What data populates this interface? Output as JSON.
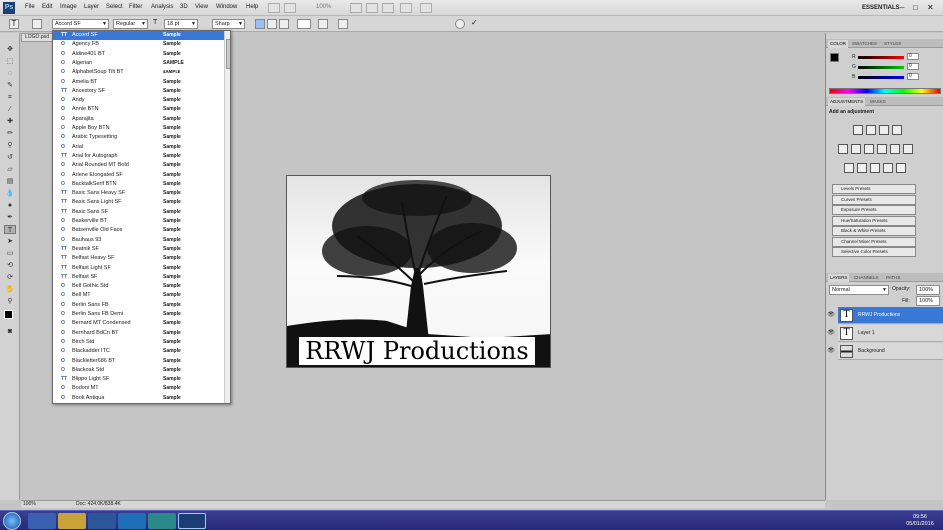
{
  "menubar": {
    "items": [
      "File",
      "Edit",
      "Image",
      "Layer",
      "Select",
      "Filter",
      "Analysis",
      "3D",
      "View",
      "Window",
      "Help"
    ],
    "zoom": "100%",
    "workspace": "ESSENTIALS",
    "window_buttons": [
      "–",
      "□",
      "✕"
    ]
  },
  "options": {
    "tool_icon": "T",
    "font_family": "Accord SF",
    "font_style": "Regular",
    "font_size": "18 pt",
    "antialias": "Sharp"
  },
  "document": {
    "tab_label": "LOGO.psd",
    "logo_text": "RRWJ Productions",
    "status_zoom": "100%",
    "status_doc": "Doc: 424.0K/838.4K"
  },
  "fontlist": {
    "sample_label": "Sample",
    "fonts": [
      {
        "icon": "TT",
        "name": "Accord SF",
        "sample": "Sample"
      },
      {
        "icon": "O",
        "name": "Agency FB",
        "sample": "Sample"
      },
      {
        "icon": "O",
        "name": "Aldine401 BT",
        "sample": "Sample"
      },
      {
        "icon": "O",
        "name": "Algerian",
        "sample": "SAMPLE"
      },
      {
        "icon": "O",
        "name": "AlphabetSoup Tilt BT",
        "sample": "ꜱᴀᴍᴘʟᴇ"
      },
      {
        "icon": "O",
        "name": "Amelia BT",
        "sample": "Sample"
      },
      {
        "icon": "TT",
        "name": "Ancestory SF",
        "sample": "Sample"
      },
      {
        "icon": "O",
        "name": "Andy",
        "sample": "Sample"
      },
      {
        "icon": "O",
        "name": "Annie BTN",
        "sample": "Sample"
      },
      {
        "icon": "O",
        "name": "Aparajita",
        "sample": "Sample"
      },
      {
        "icon": "O",
        "name": "Apple Boy BTN",
        "sample": "Sample"
      },
      {
        "icon": "O",
        "name": "Arabic Typesetting",
        "sample": "Sample"
      },
      {
        "icon": "O",
        "name": "Arial",
        "sample": "Sample"
      },
      {
        "icon": "TT",
        "name": "Arial for Autograph",
        "sample": "Sample"
      },
      {
        "icon": "O",
        "name": "Arial Rounded MT Bold",
        "sample": "Sample"
      },
      {
        "icon": "O",
        "name": "Arlene Elongated SF",
        "sample": "Sample"
      },
      {
        "icon": "O",
        "name": "BacktalkSerif BTN",
        "sample": "Sample"
      },
      {
        "icon": "TT",
        "name": "Basic Sans Heavy SF",
        "sample": "Sample"
      },
      {
        "icon": "TT",
        "name": "Basic Sans Light SF",
        "sample": "Sample"
      },
      {
        "icon": "TT",
        "name": "Basic Sans SF",
        "sample": "Sample"
      },
      {
        "icon": "O",
        "name": "Baskerville BT",
        "sample": "Sample"
      },
      {
        "icon": "O",
        "name": "Batsenville Old Face",
        "sample": "Sample"
      },
      {
        "icon": "O",
        "name": "Bauhaus 93",
        "sample": "Sample"
      },
      {
        "icon": "TT",
        "name": "Beatnik SF",
        "sample": "Sample"
      },
      {
        "icon": "TT",
        "name": "Belfast Heavy SF",
        "sample": "Sample"
      },
      {
        "icon": "TT",
        "name": "Belfast Light SF",
        "sample": "Sample"
      },
      {
        "icon": "TT",
        "name": "Belfast SF",
        "sample": "Sample"
      },
      {
        "icon": "O",
        "name": "Bell Gothic Std",
        "sample": "Sample"
      },
      {
        "icon": "O",
        "name": "Bell MT",
        "sample": "Sample"
      },
      {
        "icon": "O",
        "name": "Berlin Sans FB",
        "sample": "Sample"
      },
      {
        "icon": "O",
        "name": "Berlin Sans FB Demi",
        "sample": "Sample"
      },
      {
        "icon": "O",
        "name": "Bernard MT Condensed",
        "sample": "Sample"
      },
      {
        "icon": "O",
        "name": "Bernhard BdCn BT",
        "sample": "Sample"
      },
      {
        "icon": "O",
        "name": "Birch Std",
        "sample": "Sample"
      },
      {
        "icon": "O",
        "name": "Blackadder ITC",
        "sample": "Sample"
      },
      {
        "icon": "O",
        "name": "Blackletter686 BT",
        "sample": "Sample"
      },
      {
        "icon": "O",
        "name": "Blackoak Std",
        "sample": "Sample"
      },
      {
        "icon": "TT",
        "name": "Blippo Light SF",
        "sample": "Sample"
      },
      {
        "icon": "O",
        "name": "Bodoni MT",
        "sample": "Sample"
      },
      {
        "icon": "O",
        "name": "Book Antiqua",
        "sample": "Sample"
      }
    ]
  },
  "panels": {
    "color_tabs": [
      "COLOR",
      "SWATCHES",
      "STYLES"
    ],
    "rgb": [
      {
        "label": "R",
        "value": "0"
      },
      {
        "label": "G",
        "value": "0"
      },
      {
        "label": "B",
        "value": "0"
      }
    ],
    "adjust_tabs": [
      "ADJUSTMENTS",
      "MASKS"
    ],
    "adjust_title": "Add an adjustment",
    "presets": [
      "Levels Presets",
      "Curves Presets",
      "Exposure Presets",
      "Hue/Saturation Presets",
      "Black & White Presets",
      "Channel Mixer Presets",
      "Selective Color Presets"
    ],
    "layer_tabs": [
      "LAYERS",
      "CHANNELS",
      "PATHS"
    ],
    "blend_mode": "Normal",
    "opacity_label": "Opacity:",
    "opacity_value": "100%",
    "fill_label": "Fill:",
    "fill_value": "100%",
    "layers": [
      {
        "name": "RRWJ Productions",
        "thumb": "T"
      },
      {
        "name": "Layer 1",
        "thumb": "T"
      },
      {
        "name": "Background",
        "thumb": ""
      }
    ]
  },
  "taskbar": {
    "time": "09:56",
    "date": "05/01/2016"
  },
  "colors": {
    "accent": "#3a78d8",
    "taskbar": "#2b2c80"
  }
}
